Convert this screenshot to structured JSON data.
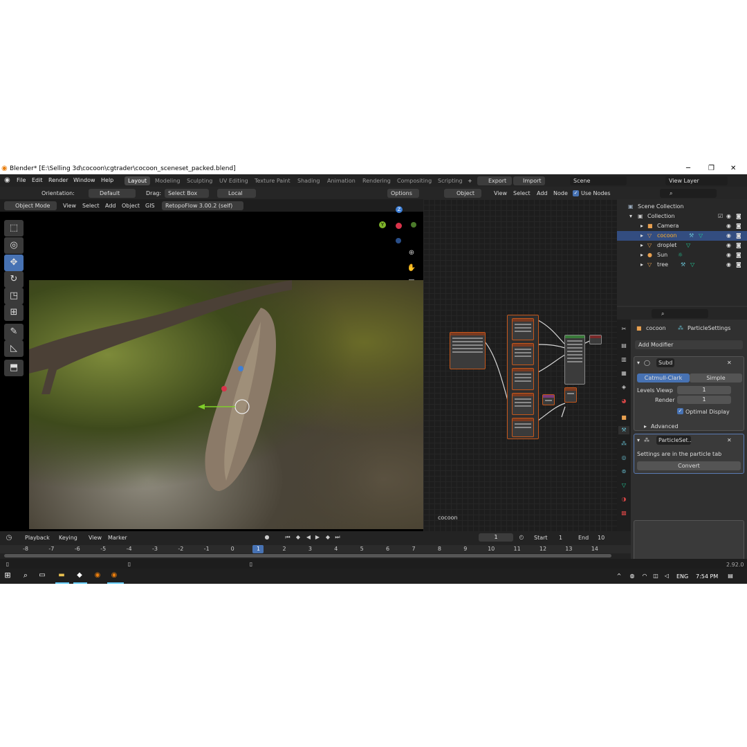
{
  "window": {
    "title": "Blender* [E:\\Selling 3d\\cocoon\\cgtrader\\cocoon_sceneset_packed.blend]",
    "min": "─",
    "max": "❐",
    "close": "✕"
  },
  "menus": [
    "File",
    "Edit",
    "Render",
    "Window",
    "Help"
  ],
  "workspaces": [
    "Layout",
    "Modeling",
    "Sculpting",
    "UV Editing",
    "Texture Paint",
    "Shading",
    "Animation",
    "Rendering",
    "Compositing",
    "Scripting"
  ],
  "top_right": {
    "export": "Export",
    "import": "Import",
    "scene": "Scene",
    "view_layer": "View Layer",
    "add_tab": "+"
  },
  "tool_header": {
    "orientation_label": "Orientation:",
    "orientation": "Default",
    "drag_label": "Drag:",
    "drag": "Select Box",
    "pivot": "Local",
    "options": "Options"
  },
  "viewport_header": {
    "mode": "Object Mode",
    "view": "View",
    "select": "Select",
    "add": "Add",
    "object": "Object",
    "gis": "GIS",
    "retopo": "RetopoFlow 3.00.2 (self)",
    "help": "?"
  },
  "node_header": {
    "object": "Object",
    "view": "View",
    "select": "Select",
    "add": "Add",
    "node": "Node",
    "use_nodes": "Use Nodes"
  },
  "node_editor": {
    "object_name": "cocoon"
  },
  "gizmo": {
    "z": "Z",
    "y": "Y"
  },
  "outliner": {
    "root": "Scene Collection",
    "collection": "Collection",
    "items": [
      {
        "name": "Camera",
        "icon": "camera-icon"
      },
      {
        "name": "cocoon",
        "icon": "mesh-icon",
        "selected": true
      },
      {
        "name": "droplet",
        "icon": "mesh-icon"
      },
      {
        "name": "Sun",
        "icon": "light-icon"
      },
      {
        "name": "tree",
        "icon": "mesh-icon"
      }
    ]
  },
  "properties": {
    "object": "cocoon",
    "particle_settings": "ParticleSettings",
    "add_modifier": "Add Modifier",
    "subd_name": "Subd",
    "catmull": "Catmull-Clark",
    "simple": "Simple",
    "levels_label": "Levels Viewp",
    "levels": "1",
    "render_label": "Render",
    "render": "1",
    "optimal": "Optimal Display",
    "advanced": "Advanced",
    "particle_name": "ParticleSet...",
    "particle_note": "Settings are in the particle tab",
    "convert": "Convert"
  },
  "timeline": {
    "playback": "Playback",
    "keying": "Keying",
    "view": "View",
    "marker": "Marker",
    "frame": "1",
    "start_label": "Start",
    "start": "1",
    "end_label": "End",
    "end": "10",
    "ticks": [
      "-8",
      "-7",
      "-6",
      "-5",
      "-4",
      "-3",
      "-2",
      "-1",
      "0",
      "1",
      "2",
      "3",
      "4",
      "5",
      "6",
      "7",
      "8",
      "9",
      "10",
      "11",
      "12",
      "13",
      "14"
    ]
  },
  "status": {
    "version": "2.92.0"
  },
  "taskbar": {
    "lang": "ENG",
    "time": "7:54 PM"
  }
}
